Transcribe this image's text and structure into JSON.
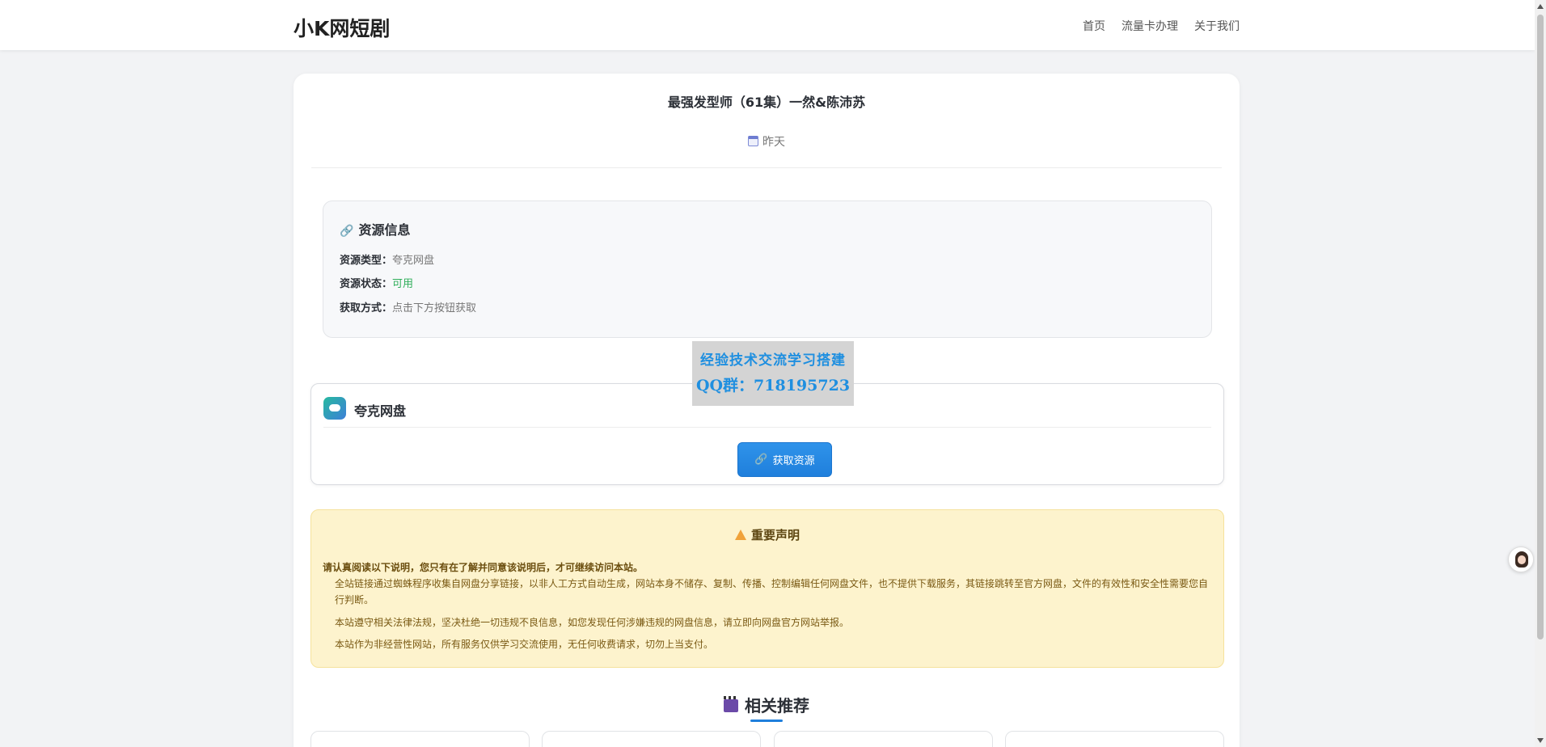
{
  "header": {
    "brand": "小K网短剧",
    "nav": [
      "首页",
      "流量卡办理",
      "关于我们"
    ]
  },
  "post": {
    "title": "最强发型师（61集）一然&陈沛苏",
    "date": "昨天",
    "date_icon": "calendar-icon"
  },
  "resource": {
    "heading": "资源信息",
    "rows": [
      {
        "k": "资源类型：",
        "v": "夸克网盘"
      },
      {
        "k": "资源状态：",
        "v": "可用"
      },
      {
        "k": "获取方式：",
        "v": "点击下方按钮获取"
      }
    ]
  },
  "watermark": {
    "line1": "经验技术交流学习搭建",
    "line2": "QQ群：718195723"
  },
  "pan": {
    "name": "夸克网盘",
    "button": "获取资源"
  },
  "notice": {
    "heading": "重要声明",
    "lead": "请认真阅读以下说明，您只有在了解并同意该说明后，才可继续访问本站。",
    "items": [
      "全站链接通过蜘蛛程序收集自网盘分享链接，以非人工方式自动生成，网站本身不储存、复制、传播、控制编辑任何网盘文件，也不提供下载服务，其链接跳转至官方网盘，文件的有效性和安全性需要您自行判断。",
      "本站遵守相关法律法规，坚决杜绝一切违规不良信息，如您发现任何涉嫌违规的网盘信息，请立即向网盘官方网站举报。",
      "本站作为非经营性网站，所有服务仅供学习交流使用，无任何收费请求，切勿上当支付。"
    ]
  },
  "related": {
    "heading": "相关推荐"
  },
  "colors": {
    "accent": "#1f7fdc",
    "ok": "#2fae5a",
    "notice_bg": "#fdf3cd"
  }
}
